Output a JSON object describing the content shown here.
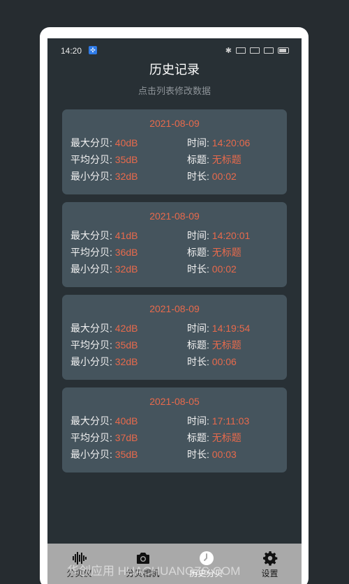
{
  "status_bar": {
    "time": "14:20"
  },
  "header": {
    "title": "历史记录",
    "subtitle": "点击列表修改数据"
  },
  "records": [
    {
      "date": "2021-08-09",
      "max_label": "最大分贝:",
      "max": "40dB",
      "avg_label": "平均分贝:",
      "avg": "35dB",
      "min_label": "最小分贝:",
      "min": "32dB",
      "time_label": "时间:",
      "time": "14:20:06",
      "title_label": "标题:",
      "title": "无标题",
      "duration_label": "时长:",
      "duration": "00:02"
    },
    {
      "date": "2021-08-09",
      "max_label": "最大分贝:",
      "max": "41dB",
      "avg_label": "平均分贝:",
      "avg": "36dB",
      "min_label": "最小分贝:",
      "min": "32dB",
      "time_label": "时间:",
      "time": "14:20:01",
      "title_label": "标题:",
      "title": "无标题",
      "duration_label": "时长:",
      "duration": "00:02"
    },
    {
      "date": "2021-08-09",
      "max_label": "最大分贝:",
      "max": "42dB",
      "avg_label": "平均分贝:",
      "avg": "35dB",
      "min_label": "最小分贝:",
      "min": "32dB",
      "time_label": "时间:",
      "time": "14:19:54",
      "title_label": "标题:",
      "title": "无标题",
      "duration_label": "时长:",
      "duration": "00:06"
    },
    {
      "date": "2021-08-05",
      "max_label": "最大分贝:",
      "max": "40dB",
      "avg_label": "平均分贝:",
      "avg": "37dB",
      "min_label": "最小分贝:",
      "min": "35dB",
      "time_label": "时间:",
      "time": "17:11:03",
      "title_label": "标题:",
      "title": "无标题",
      "duration_label": "时长:",
      "duration": "00:03"
    }
  ],
  "nav": {
    "items": [
      {
        "label": "分贝仪",
        "icon": "waveform-icon"
      },
      {
        "label": "分贝相机",
        "icon": "camera-icon"
      },
      {
        "label": "历史分贝",
        "icon": "clock-icon",
        "active": true
      },
      {
        "label": "设置",
        "icon": "gear-icon"
      }
    ]
  },
  "watermark": "华创应用 HUACHUANGZS.COM",
  "colors": {
    "background": "#283035",
    "card": "#45545d",
    "accent": "#e86a4c",
    "nav_bar": "#a9a9a9"
  }
}
